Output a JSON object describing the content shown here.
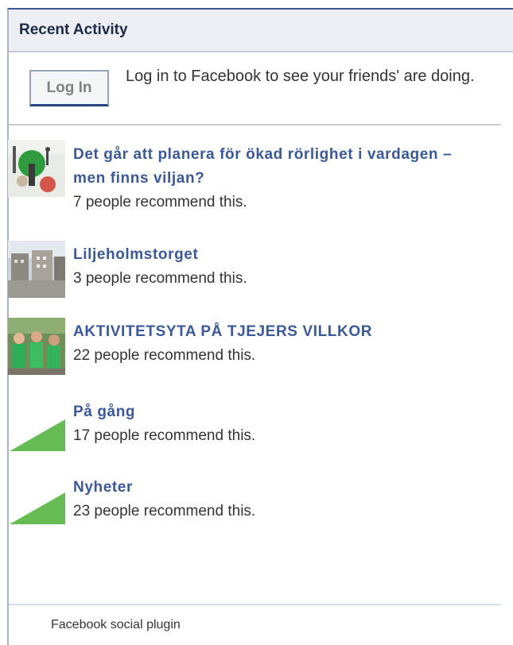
{
  "widget": {
    "title": "Recent Activity",
    "login_button": "Log In",
    "login_message": "Log in to Facebook to see your friends' are doing.",
    "footer": "Facebook social plugin"
  },
  "items": [
    {
      "title": "Det går att planera för ökad rörlighet i vardagen – men finns viljan?",
      "count": "7 people recommend this.",
      "thumb": "green-sculpture-photo"
    },
    {
      "title": "Liljeholmstorget",
      "count": "3 people recommend this.",
      "thumb": "square-buildings-photo"
    },
    {
      "title": "AKTIVITETSYTA PÅ TJEJERS VILLKOR",
      "count": "22 people recommend this.",
      "thumb": "group-people-photo"
    },
    {
      "title": "På gång",
      "count": "17 people recommend this.",
      "thumb": "green-triangle-logo"
    },
    {
      "title": "Nyheter",
      "count": "23 people recommend this.",
      "thumb": "green-triangle-logo"
    }
  ],
  "colors": {
    "link": "#3b5998",
    "accent_border": "#3b5998",
    "header_bg": "#edeff4"
  }
}
